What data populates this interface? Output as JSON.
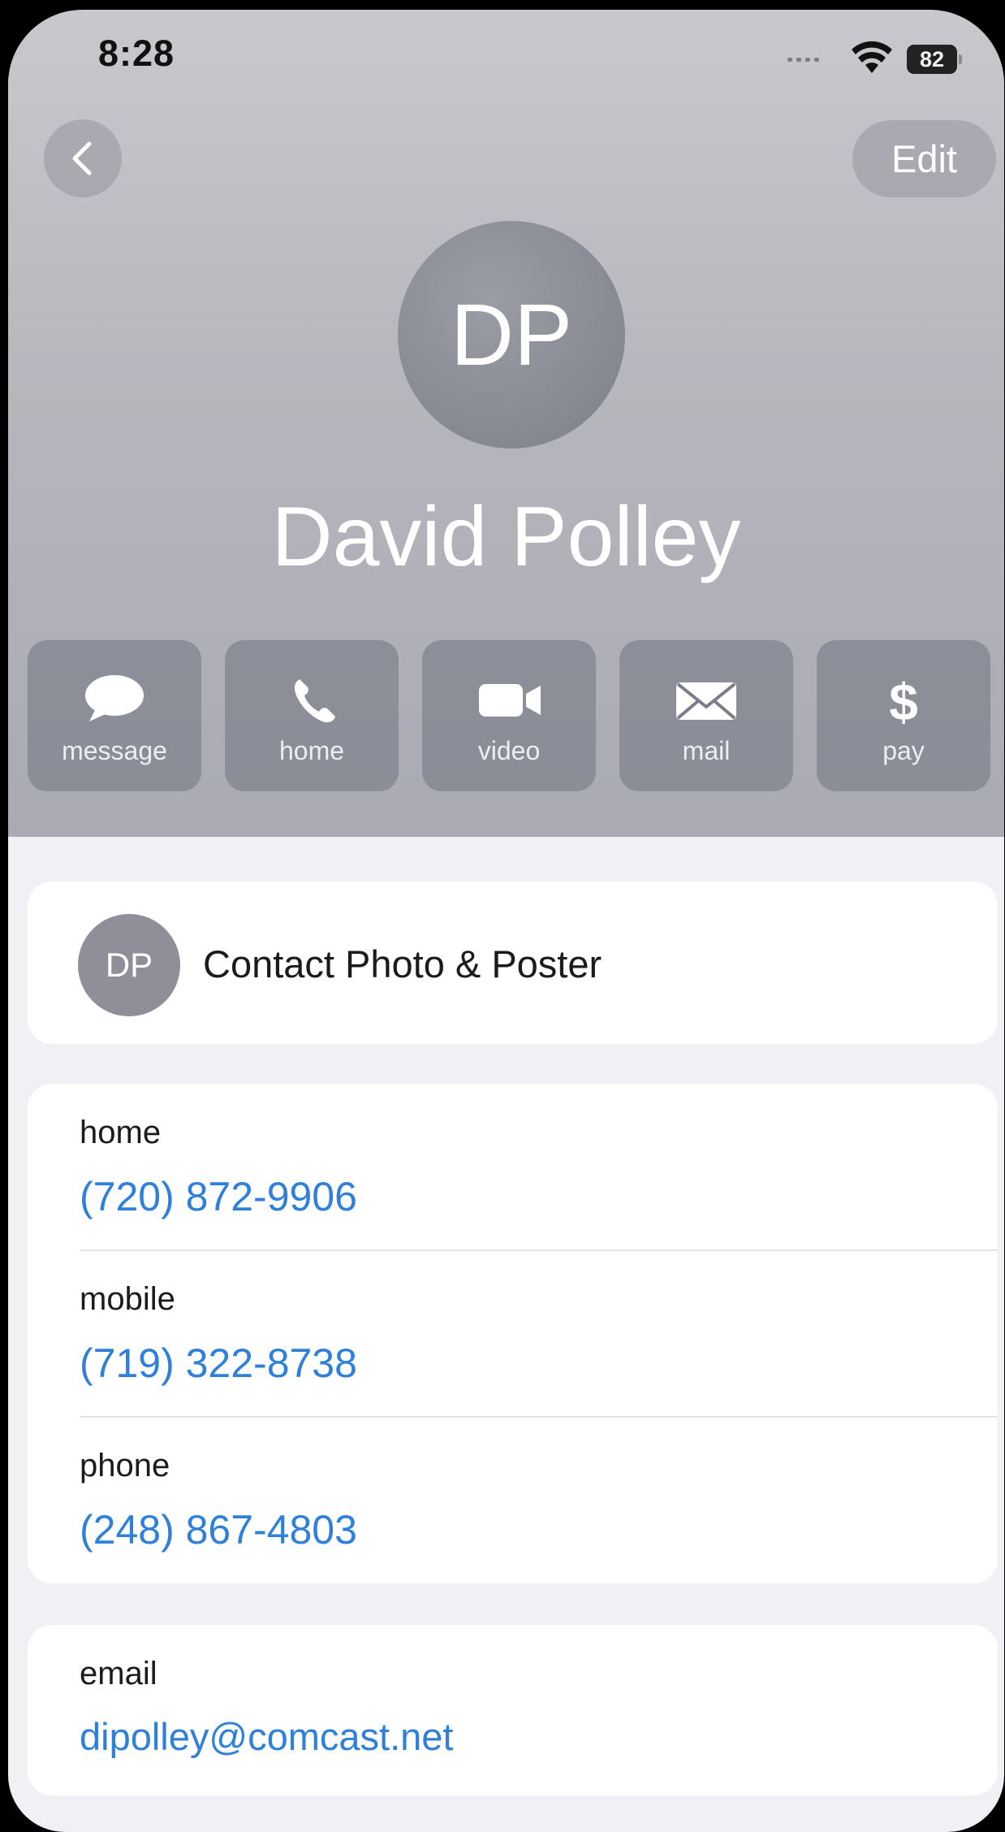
{
  "status_bar": {
    "time": "8:28",
    "battery": "82"
  },
  "nav": {
    "edit_label": "Edit"
  },
  "contact": {
    "initials": "DP",
    "name": "David Polley"
  },
  "actions": [
    {
      "label": "message",
      "icon": "message-bubble-icon"
    },
    {
      "label": "home",
      "icon": "phone-icon"
    },
    {
      "label": "video",
      "icon": "video-camera-icon"
    },
    {
      "label": "mail",
      "icon": "envelope-icon"
    },
    {
      "label": "pay",
      "icon": "dollar-icon"
    }
  ],
  "photo_poster": {
    "initials": "DP",
    "label": "Contact Photo & Poster"
  },
  "phones": [
    {
      "label": "home",
      "number": "(720) 872-9906"
    },
    {
      "label": "mobile",
      "number": "(719) 322-8738"
    },
    {
      "label": "phone",
      "number": "(248) 867-4803"
    }
  ],
  "email": {
    "label": "email",
    "address": "dipolley@comcast.net"
  },
  "colors": {
    "link": "#2f80d8",
    "header_top": "#c8c8cd",
    "header_bottom": "#a9aab3",
    "action_bg": "#787a86"
  }
}
